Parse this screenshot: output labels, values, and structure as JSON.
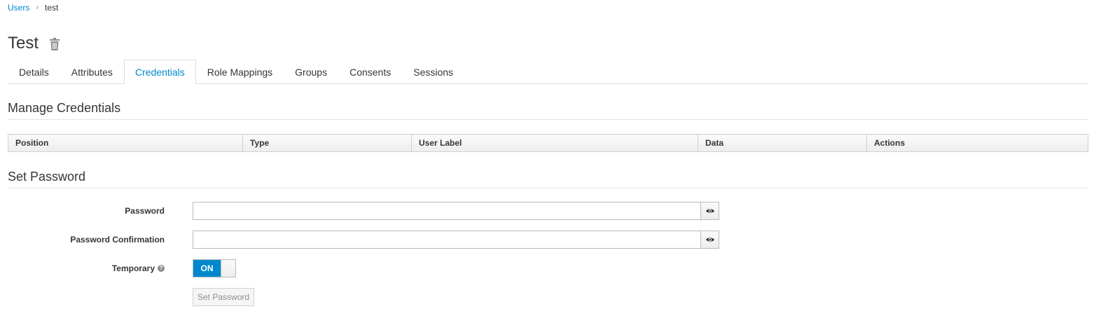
{
  "breadcrumb": {
    "parent": "Users",
    "separator": "›",
    "current": "test"
  },
  "page": {
    "title": "Test",
    "delete_icon": "trash-icon"
  },
  "tabs": [
    {
      "label": "Details",
      "active": false
    },
    {
      "label": "Attributes",
      "active": false
    },
    {
      "label": "Credentials",
      "active": true
    },
    {
      "label": "Role Mappings",
      "active": false
    },
    {
      "label": "Groups",
      "active": false
    },
    {
      "label": "Consents",
      "active": false
    },
    {
      "label": "Sessions",
      "active": false
    }
  ],
  "manage_credentials": {
    "title": "Manage Credentials",
    "columns": [
      "Position",
      "Type",
      "User Label",
      "Data",
      "Actions"
    ],
    "rows": []
  },
  "set_password": {
    "title": "Set Password",
    "password": {
      "label": "Password",
      "value": "",
      "reveal_icon": "eye-icon"
    },
    "password_confirmation": {
      "label": "Password Confirmation",
      "value": "",
      "reveal_icon": "eye-icon"
    },
    "temporary": {
      "label": "Temporary",
      "help_icon": "question-circle-icon",
      "help_glyph": "?",
      "state": "ON"
    },
    "submit_label": "Set Password"
  },
  "colors": {
    "link": "#0088ce",
    "toggle_on": "#0088ce",
    "text": "#363636"
  }
}
